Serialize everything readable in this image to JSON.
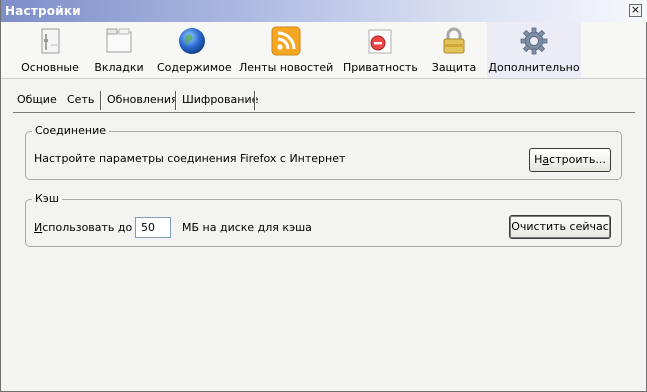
{
  "window": {
    "title": "Настройки",
    "close_glyph": "×"
  },
  "toolbar": {
    "items": [
      {
        "label": "Основные",
        "icon": "general-icon"
      },
      {
        "label": "Вкладки",
        "icon": "tabs-icon"
      },
      {
        "label": "Содержимое",
        "icon": "globe-icon"
      },
      {
        "label": "Ленты новостей",
        "icon": "rss-icon"
      },
      {
        "label": "Приватность",
        "icon": "privacy-icon"
      },
      {
        "label": "Защита",
        "icon": "padlock-icon"
      },
      {
        "label": "Дополнительно",
        "icon": "gear-icon",
        "selected": true
      }
    ]
  },
  "subtabs": [
    {
      "label": "Общие"
    },
    {
      "label": "Сеть",
      "selected": true
    },
    {
      "label": "Обновления"
    },
    {
      "label": "Шифрование"
    }
  ],
  "connection": {
    "legend": "Соединение",
    "text": "Настройте параметры соединения Firefox с Интернет",
    "button_prefix": "Н",
    "button_accel": "а",
    "button_rest": "строить..."
  },
  "cache": {
    "legend": "Кэш",
    "use_label_accel": "И",
    "use_label_rest": "спользовать до",
    "size_value": "50",
    "unit_text": "МБ на диске для кэша",
    "clear_button": "Очистить сейчас"
  },
  "colors": {
    "title_start": "#7d8ec9",
    "title_end": "#f7f8fc",
    "background": "#f3f3f1",
    "rss": "#f5a623",
    "globe": "#2a6bd1"
  }
}
